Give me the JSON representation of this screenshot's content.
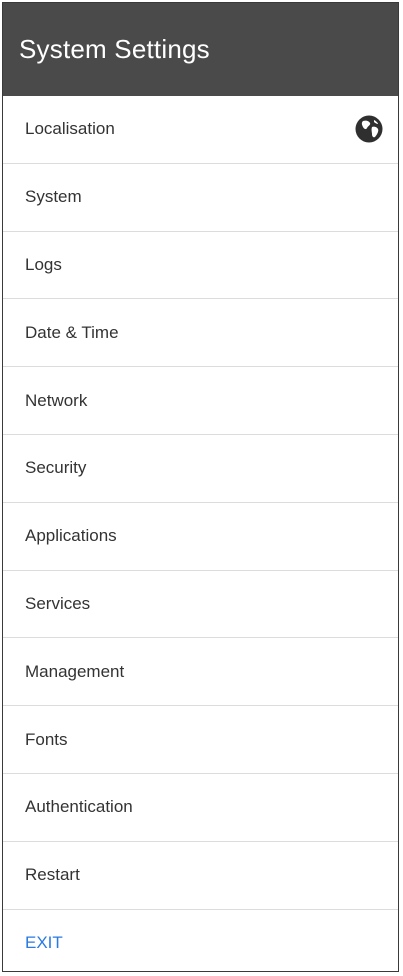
{
  "header": {
    "title": "System Settings"
  },
  "menu": {
    "items": [
      {
        "label": "Localisation",
        "icon": "globe-icon"
      },
      {
        "label": "System"
      },
      {
        "label": "Logs"
      },
      {
        "label": "Date & Time"
      },
      {
        "label": "Network"
      },
      {
        "label": "Security"
      },
      {
        "label": "Applications"
      },
      {
        "label": "Services"
      },
      {
        "label": "Management"
      },
      {
        "label": "Fonts"
      },
      {
        "label": "Authentication"
      },
      {
        "label": "Restart"
      }
    ],
    "exit_label": "EXIT"
  },
  "colors": {
    "header_bg": "#4a4a4a",
    "header_text": "#ffffff",
    "item_text": "#333333",
    "exit_text": "#2a7ae2",
    "divider": "#dcdcdc"
  }
}
